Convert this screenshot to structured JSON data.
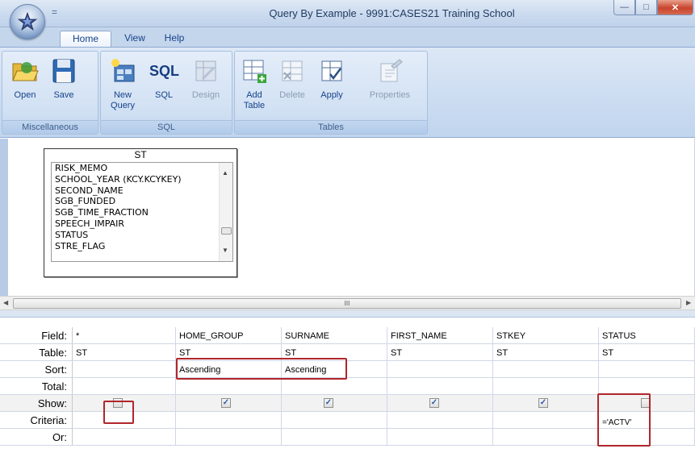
{
  "window": {
    "title": "Query By Example - 9991:CASES21 Training School",
    "qat_glyph": "=",
    "buttons": {
      "minimize": "—",
      "maximize": "□",
      "close": "✕"
    }
  },
  "tabs": [
    {
      "label": "Home",
      "active": true
    },
    {
      "label": "View",
      "active": false
    },
    {
      "label": "Help",
      "active": false
    }
  ],
  "ribbon": {
    "groups": [
      {
        "label": "Miscellaneous",
        "buttons": [
          {
            "label": "Open",
            "icon": "open-folder-icon"
          },
          {
            "label": "Save",
            "icon": "floppy-disk-icon"
          }
        ]
      },
      {
        "label": "SQL",
        "buttons": [
          {
            "label": "New Query",
            "icon": "new-query-icon"
          },
          {
            "label": "SQL",
            "icon": "sql-icon"
          },
          {
            "label": "Design",
            "icon": "design-icon",
            "disabled": true
          }
        ]
      },
      {
        "label": "Tables",
        "buttons": [
          {
            "label": "Add Table",
            "icon": "add-table-icon"
          },
          {
            "label": "Delete",
            "icon": "delete-table-icon",
            "disabled": true
          },
          {
            "label": "Apply",
            "icon": "apply-icon"
          },
          {
            "label": "Properties",
            "icon": "properties-icon",
            "disabled": true
          }
        ]
      }
    ],
    "new_query_line1": "New",
    "new_query_line2": "Query",
    "add_table_line1": "Add",
    "add_table_line2": "Table",
    "sql_icon_text": "SQL"
  },
  "table_box": {
    "title": "ST",
    "fields": [
      "RISK_MEMO",
      "SCHOOL_YEAR (KCY.KCYKEY)",
      "SECOND_NAME",
      "SGB_FUNDED",
      "SGB_TIME_FRACTION",
      "SPEECH_IMPAIR",
      "STATUS",
      "STRE_FLAG"
    ]
  },
  "hscroll_grip": "III",
  "grid": {
    "row_labels": {
      "field": "Field:",
      "table": "Table:",
      "sort": "Sort:",
      "total": "Total:",
      "show": "Show:",
      "criteria": "Criteria:",
      "or": "Or:"
    },
    "columns": [
      {
        "field": "*",
        "table": "ST",
        "sort": "",
        "show": false,
        "criteria": ""
      },
      {
        "field": "HOME_GROUP",
        "table": "ST",
        "sort": "Ascending",
        "show": true,
        "criteria": ""
      },
      {
        "field": "SURNAME",
        "table": "ST",
        "sort": "Ascending",
        "show": true,
        "criteria": ""
      },
      {
        "field": "FIRST_NAME",
        "table": "ST",
        "sort": "",
        "show": true,
        "criteria": ""
      },
      {
        "field": "STKEY",
        "table": "ST",
        "sort": "",
        "show": true,
        "criteria": ""
      },
      {
        "field": "STATUS",
        "table": "ST",
        "sort": "",
        "show": false,
        "criteria": "='ACTV'"
      }
    ],
    "check_mark": "✓"
  },
  "colors": {
    "highlight": "#b0262b",
    "ribbon": "#c8daf0",
    "accent_text": "#15428b"
  }
}
